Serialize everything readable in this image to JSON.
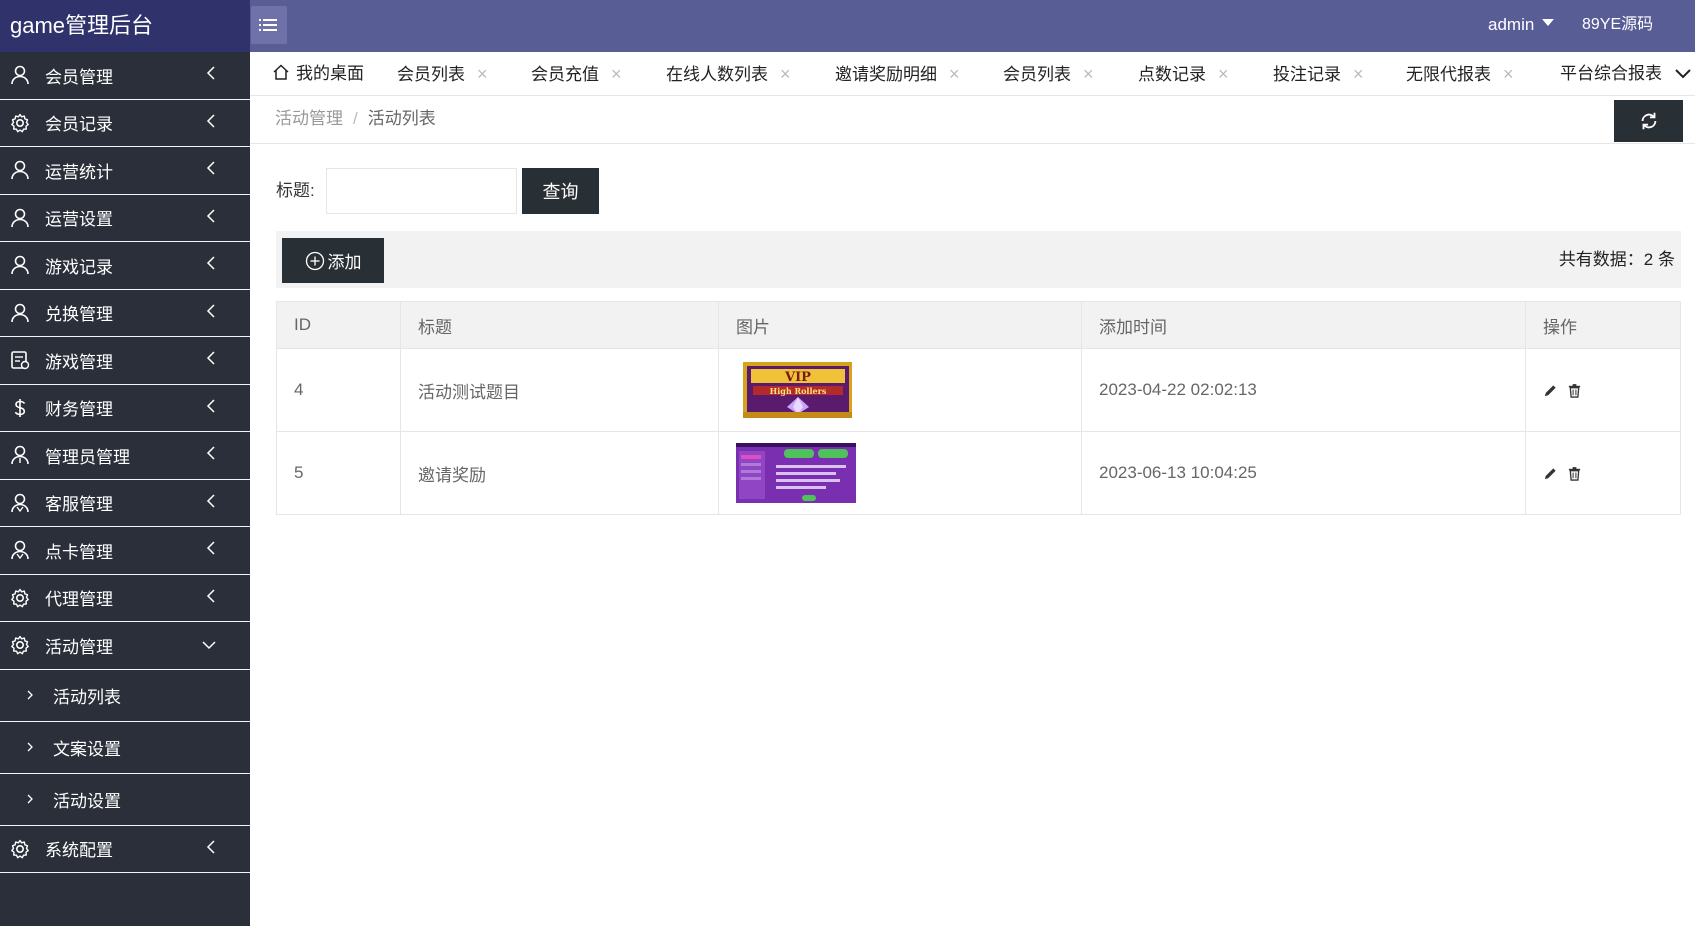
{
  "header": {
    "app_title": "game管理后台",
    "user": "admin",
    "brand": "89YE源码"
  },
  "sidebar": {
    "items": [
      {
        "label": "会员管理",
        "icon": "user-icon"
      },
      {
        "label": "会员记录",
        "icon": "gear-icon"
      },
      {
        "label": "运营统计",
        "icon": "user-icon"
      },
      {
        "label": "运营设置",
        "icon": "user-icon"
      },
      {
        "label": "游戏记录",
        "icon": "user-icon"
      },
      {
        "label": "兑换管理",
        "icon": "user-icon"
      },
      {
        "label": "游戏管理",
        "icon": "document-icon"
      },
      {
        "label": "财务管理",
        "icon": "dollar-icon"
      },
      {
        "label": "管理员管理",
        "icon": "admin-user-icon"
      },
      {
        "label": "客服管理",
        "icon": "support-user-icon"
      },
      {
        "label": "点卡管理",
        "icon": "support-user-icon"
      },
      {
        "label": "代理管理",
        "icon": "gear-icon"
      },
      {
        "label": "活动管理",
        "icon": "gear-icon",
        "expanded": true
      },
      {
        "label": "系统配置",
        "icon": "gear-icon"
      }
    ],
    "sub_items": [
      "活动列表",
      "文案设置",
      "活动设置"
    ]
  },
  "tabs": [
    {
      "label": "我的桌面",
      "closable": false
    },
    {
      "label": "会员列表",
      "closable": true
    },
    {
      "label": "会员充值",
      "closable": true
    },
    {
      "label": "在线人数列表",
      "closable": true
    },
    {
      "label": "邀请奖励明细",
      "closable": true
    },
    {
      "label": "会员列表",
      "closable": true
    },
    {
      "label": "点数记录",
      "closable": true
    },
    {
      "label": "投注记录",
      "closable": true
    },
    {
      "label": "无限代报表",
      "closable": true
    },
    {
      "label": "平台综合报表",
      "closable": false
    }
  ],
  "tab_close_glyph": "×",
  "breadcrumb": {
    "parent": "活动管理",
    "separator": "/",
    "current": "活动列表"
  },
  "search": {
    "label": "标题:",
    "value": "",
    "button": "查询"
  },
  "toolbar": {
    "add_label": "添加",
    "total_text": "共有数据：2 条"
  },
  "table": {
    "columns": [
      "ID",
      "标题",
      "图片",
      "添加时间",
      "操作"
    ],
    "rows": [
      {
        "id": "4",
        "title": "活动测试题目",
        "image": "vip-high-rollers-banner",
        "time": "2023-04-22 02:02:13"
      },
      {
        "id": "5",
        "title": "邀请奖励",
        "image": "invite-reward-screenshot",
        "time": "2023-06-13 10:04:25"
      }
    ]
  },
  "colors": {
    "header_bg": "#595d96",
    "logo_bg": "#2f326b",
    "sidebar_bg": "#2a2f3a",
    "button_bg": "#283036"
  }
}
